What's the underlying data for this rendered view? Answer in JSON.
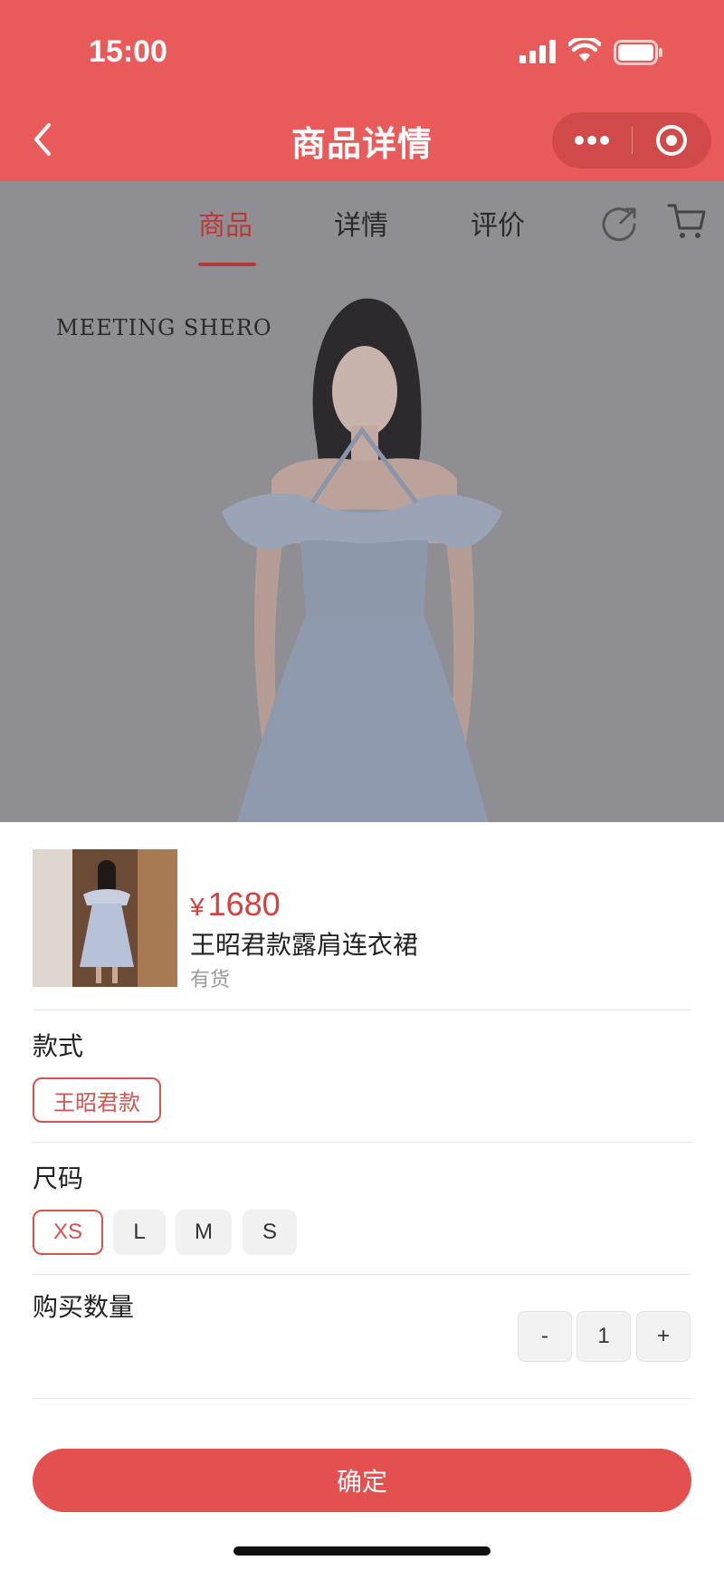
{
  "status_bar": {
    "time": "15:00"
  },
  "nav_bar": {
    "title": "商品详情",
    "back_icon": "chevron-left-icon",
    "more_icon": "more-dots-icon",
    "close_icon": "target-circle-icon",
    "color": "#e95b5b"
  },
  "tabs": [
    {
      "label": "商品",
      "active": true
    },
    {
      "label": "详情",
      "active": false
    },
    {
      "label": "评价",
      "active": false
    }
  ],
  "tab_icons": {
    "share": "share-icon",
    "cart": "cart-icon"
  },
  "product_image": {
    "brand_text": "MEETING SHERO"
  },
  "sheet": {
    "price_symbol": "¥",
    "price": "1680",
    "name": "王昭君款露肩连衣裙",
    "stock": "有货",
    "style_section": {
      "label": "款式",
      "options": [
        {
          "label": "王昭君款",
          "selected": true
        }
      ]
    },
    "size_section": {
      "label": "尺码",
      "options": [
        {
          "label": "XS",
          "selected": true
        },
        {
          "label": "L",
          "selected": false
        },
        {
          "label": "M",
          "selected": false
        },
        {
          "label": "S",
          "selected": false
        }
      ]
    },
    "quantity_section": {
      "label": "购买数量",
      "minus": "-",
      "value": "1",
      "plus": "+"
    },
    "confirm": "确定"
  },
  "colors": {
    "accent": "#e44f4f",
    "price": "#d6403f",
    "overlay": "#8f8f93"
  }
}
